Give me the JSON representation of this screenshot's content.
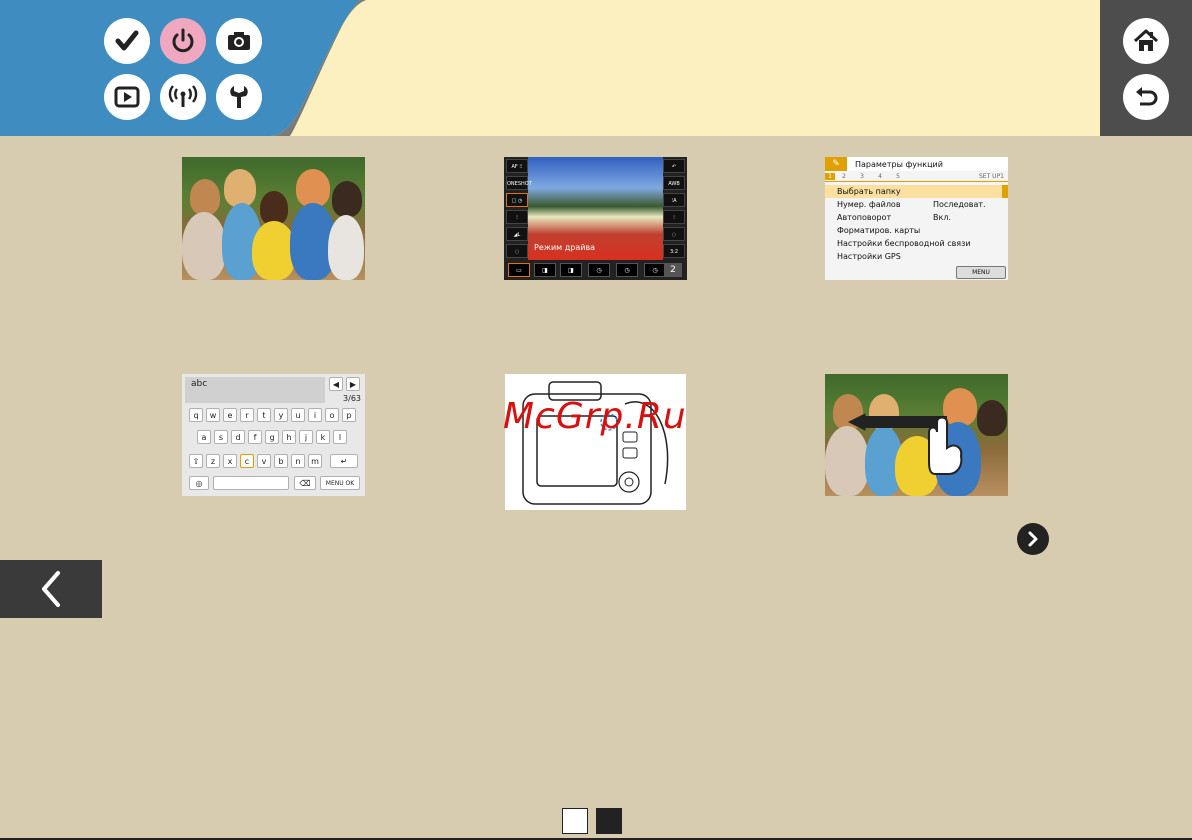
{
  "header": {
    "icons": [
      {
        "name": "checkmark-icon",
        "highlight": false
      },
      {
        "name": "power-icon",
        "highlight": true
      },
      {
        "name": "camera-icon",
        "highlight": false
      },
      {
        "name": "playback-icon",
        "highlight": false
      },
      {
        "name": "wireless-icon",
        "highlight": false
      },
      {
        "name": "wrench-icon",
        "highlight": false
      }
    ],
    "nav": [
      "home-icon",
      "return-icon"
    ],
    "colors": {
      "blue": "#3e8cc0",
      "cream": "#fdf0c0",
      "dark": "#4d4d4d",
      "pink": "#f0a8c0"
    }
  },
  "menu": {
    "title": "Параметры функций",
    "tabs": [
      "1",
      "2",
      "3",
      "4",
      "5"
    ],
    "tab_right": "SET UP1",
    "rows": [
      {
        "label": "Выбрать папку",
        "value": ""
      },
      {
        "label": "Нумер. файлов",
        "value": "Последоват."
      },
      {
        "label": "Автоповорот",
        "value": "Вкл."
      },
      {
        "label": "Форматиров. карты",
        "value": ""
      },
      {
        "label": "Настройки беспроводной связи",
        "value": ""
      },
      {
        "label": "Настройки GPS",
        "value": ""
      }
    ],
    "footer": "MENU"
  },
  "liveview": {
    "label": "Режим драйва",
    "left": [
      "AF ⁝⁝",
      "ONESHOT",
      "□ ◷",
      "⁝",
      "◢L",
      "◌"
    ],
    "right": [
      "↶",
      "AWB",
      "⁝A",
      "⁝",
      "◌",
      "3:2"
    ],
    "bottom_value": "2"
  },
  "keyboard": {
    "text": "abc",
    "count": "3/63",
    "row1": [
      "q",
      "w",
      "e",
      "r",
      "t",
      "y",
      "u",
      "i",
      "o",
      "p"
    ],
    "row2": [
      "a",
      "s",
      "d",
      "f",
      "g",
      "h",
      "j",
      "k",
      "l"
    ],
    "row3": [
      "z",
      "x",
      "c",
      "v",
      "b",
      "n",
      "m"
    ],
    "ok": "MENU OK"
  },
  "watermark": "McGrp.Ru"
}
